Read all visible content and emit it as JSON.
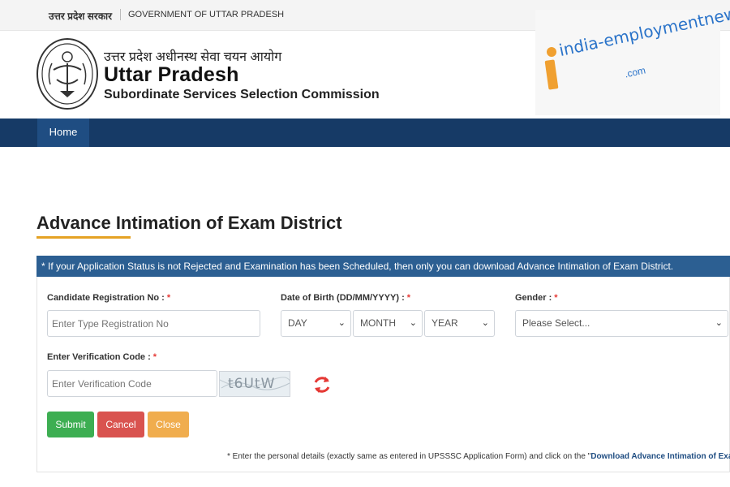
{
  "topbar": {
    "hindi": "उत्तर प्रदेश सरकार",
    "english": "GOVERNMENT OF UTTAR PRADESH"
  },
  "header": {
    "hindi_title": "उत्तर प्रदेश अधीनस्थ सेवा चयन आयोग",
    "title": "Uttar Pradesh",
    "subtitle": "Subordinate Services Selection Commission"
  },
  "watermark": {
    "text": "india-employmentnews",
    "suffix": ".com"
  },
  "nav": {
    "items": [
      {
        "label": "Home"
      }
    ]
  },
  "page": {
    "title": "Advance Intimation of Exam District"
  },
  "notice": "* If your Application Status is not Rejected and Examination has been Scheduled, then only you can download Advance Intimation of Exam District.",
  "form": {
    "registration": {
      "label": "Candidate Registration No :",
      "required": "*",
      "placeholder": "Enter Type Registration No"
    },
    "dob": {
      "label": "Date of Birth (DD/MM/YYYY) :",
      "required": "*",
      "day": "DAY",
      "month": "MONTH",
      "year": "YEAR"
    },
    "gender": {
      "label": "Gender :",
      "required": "*",
      "value": "Please Select..."
    },
    "verification": {
      "label": "Enter Verification Code :",
      "required": "*",
      "placeholder": "Enter Verification Code"
    },
    "captcha_text": "t6UtW",
    "buttons": {
      "submit": "Submit",
      "cancel": "Cancel",
      "close": "Close"
    }
  },
  "footnote": {
    "text": "* Enter the personal details (exactly same as entered in UPSSSC Application Form) and click on the \"",
    "bold": "Download Advance Intimation of Exam District"
  },
  "colors": {
    "navbar": "#163a66",
    "notice": "#2c5f92",
    "accent": "#e5a224",
    "submit": "#3dae52",
    "cancel": "#d9534f",
    "close": "#f0ad4e"
  }
}
